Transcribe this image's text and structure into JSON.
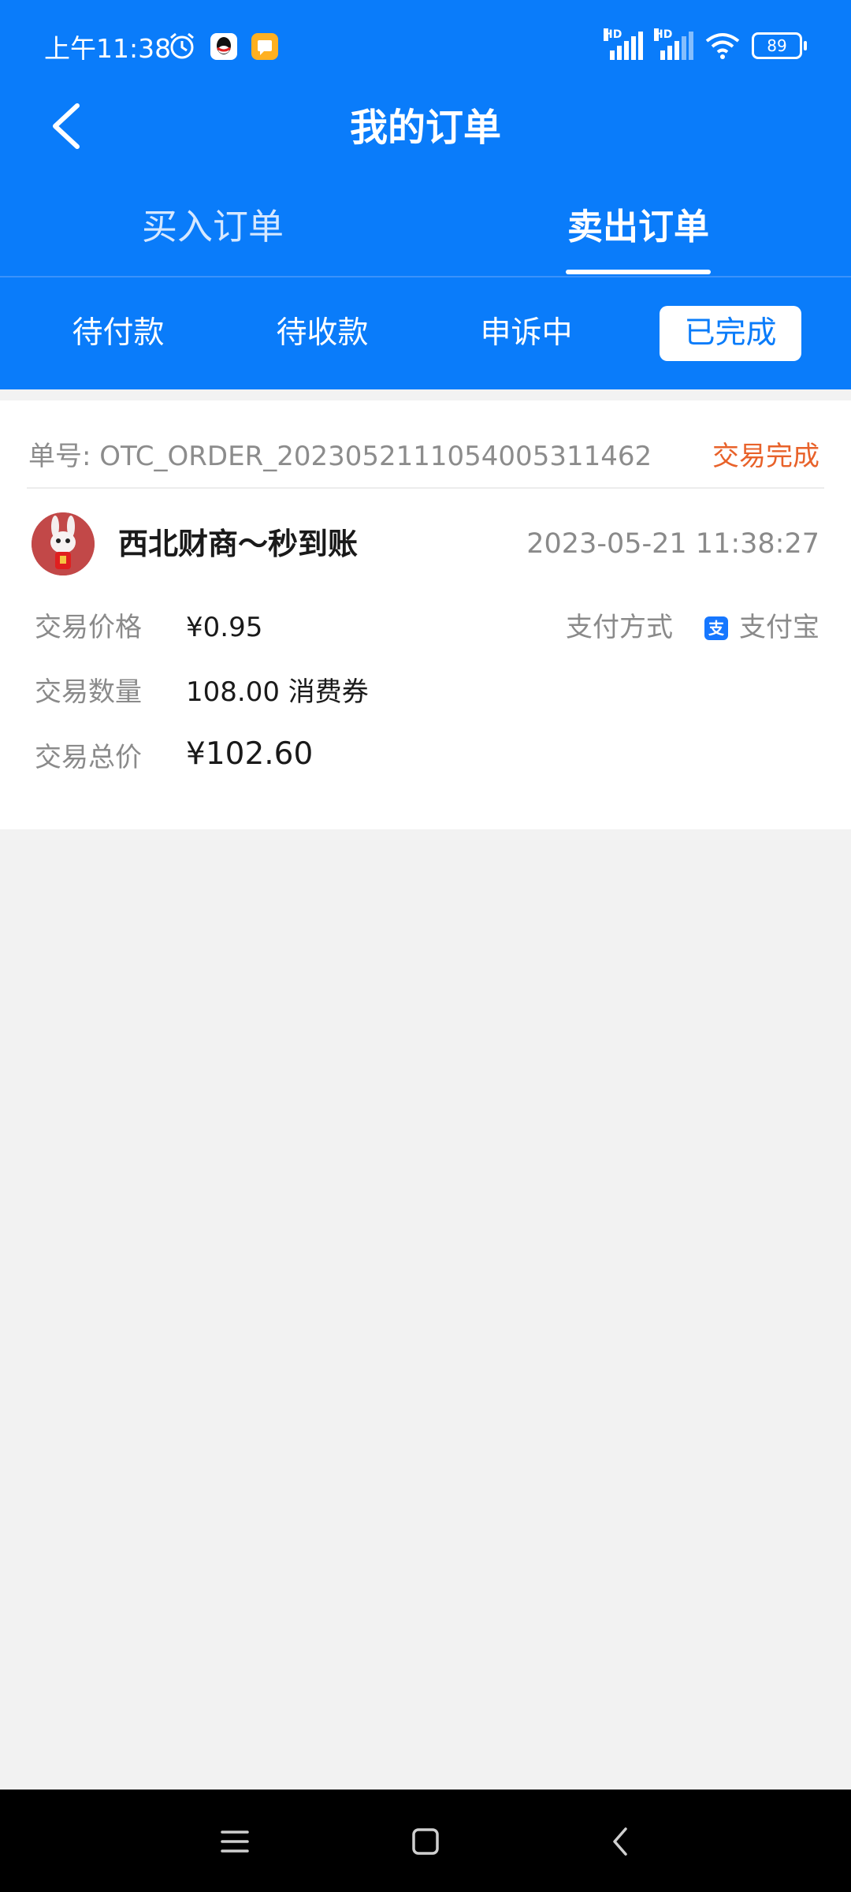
{
  "status_bar": {
    "time": "上午11:38",
    "battery": "89",
    "icons": [
      "alarm-icon",
      "qq-icon",
      "notification-app-icon",
      "hd-signal-icon",
      "hd-signal-icon",
      "wifi-icon",
      "battery-icon"
    ]
  },
  "nav": {
    "title": "我的订单",
    "back_icon": "chevron-left-icon"
  },
  "main_tabs": [
    {
      "label": "买入订单",
      "active": false
    },
    {
      "label": "卖出订单",
      "active": true
    }
  ],
  "sub_tabs": [
    {
      "label": "待付款",
      "active": false
    },
    {
      "label": "待收款",
      "active": false
    },
    {
      "label": "申诉中",
      "active": false
    },
    {
      "label": "已完成",
      "active": true
    }
  ],
  "order": {
    "order_no": "单号: OTC_ORDER_20230521110540053114​62",
    "status": "交易完成",
    "merchant": "西北财商～秒到账",
    "time": "2023-05-21 11:38:27",
    "price_label": "交易价格",
    "price": "¥0.95",
    "pay_label": "支付方式",
    "pay_icon": "alipay-icon",
    "pay_icon_glyph": "支",
    "pay_method": "支付宝",
    "qty_label": "交易数量",
    "qty": "108.00 消费券",
    "total_label": "交易总价",
    "total": "¥102.60"
  },
  "colors": {
    "header_bg": "#0a7cfa",
    "status_accent": "#e8622a",
    "page_bg": "#f2f2f2"
  }
}
